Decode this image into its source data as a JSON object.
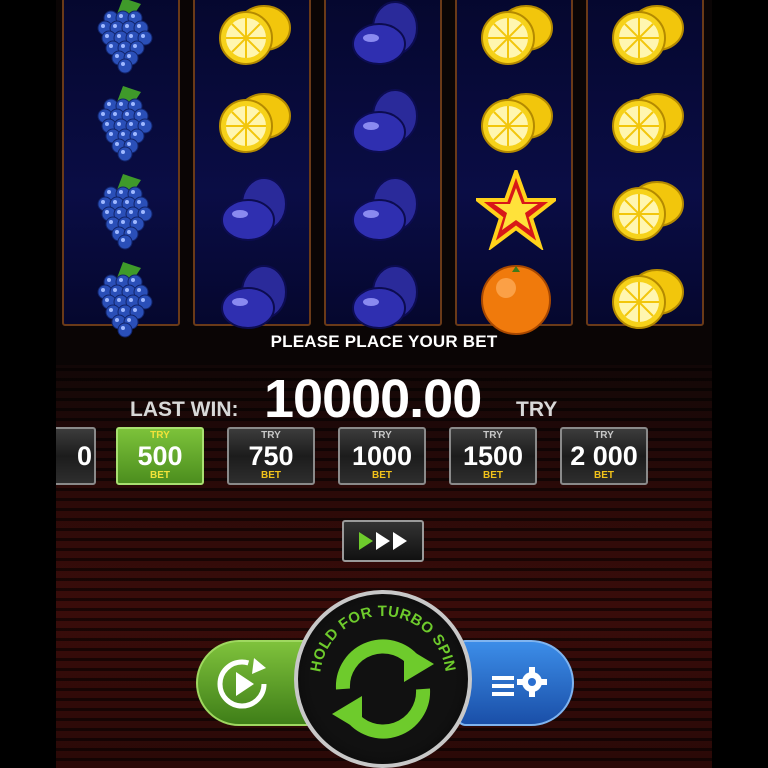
{
  "reels": [
    [
      "grapes",
      "grapes",
      "grapes",
      "grapes"
    ],
    [
      "lemon",
      "lemon",
      "plum",
      "plum"
    ],
    [
      "plum",
      "plum",
      "plum",
      "plum"
    ],
    [
      "lemon",
      "lemon",
      "star",
      "orange"
    ],
    [
      "lemon",
      "lemon",
      "lemon",
      "lemon"
    ]
  ],
  "status": {
    "message": "PLEASE PLACE YOUR BET"
  },
  "last_win": {
    "label": "LAST WIN:",
    "value": "10000.00",
    "currency": "TRY"
  },
  "bets": {
    "partial_amount": "0",
    "options": [
      {
        "currency": "TRY",
        "amount": "500",
        "label": "BET",
        "selected": true
      },
      {
        "currency": "TRY",
        "amount": "750",
        "label": "BET",
        "selected": false
      },
      {
        "currency": "TRY",
        "amount": "1000",
        "label": "BET",
        "selected": false
      },
      {
        "currency": "TRY",
        "amount": "1500",
        "label": "BET",
        "selected": false
      },
      {
        "currency": "TRY",
        "amount": "2 000",
        "label": "BET",
        "selected": false
      }
    ]
  },
  "controls": {
    "spin_hint": "HOLD FOR TURBO SPIN",
    "autoplay_icon": "fast-forward-icon",
    "restart_icon": "replay-icon",
    "settings_icon": "menu-settings-icon",
    "spin_icon": "spin-arrows-icon"
  },
  "colors": {
    "selected_bet": "#5fae2a",
    "spin_green": "#6ecb2c",
    "settings_blue": "#2a6fd0"
  }
}
